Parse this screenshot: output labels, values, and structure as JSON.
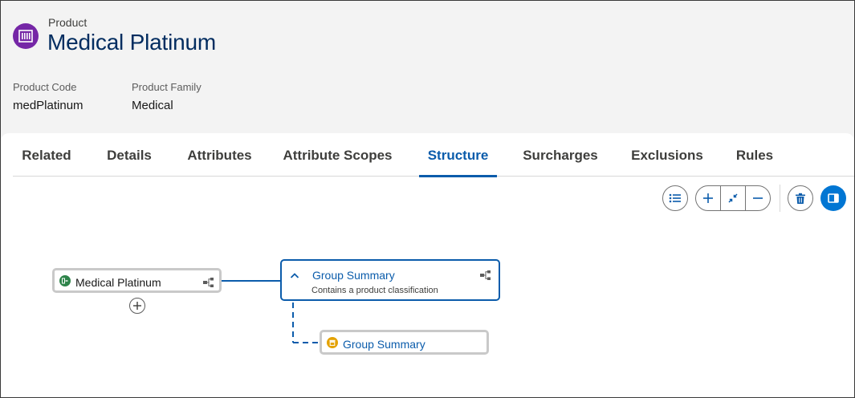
{
  "header": {
    "object_label": "Product",
    "title": "Medical Platinum",
    "icon": "product-icon",
    "fields": [
      {
        "label": "Product Code",
        "value": "medPlatinum"
      },
      {
        "label": "Product Family",
        "value": "Medical"
      }
    ]
  },
  "tabs": [
    {
      "label": "Related",
      "active": false
    },
    {
      "label": "Details",
      "active": false
    },
    {
      "label": "Attributes",
      "active": false
    },
    {
      "label": "Attribute Scopes",
      "active": false
    },
    {
      "label": "Structure",
      "active": true
    },
    {
      "label": "Surcharges",
      "active": false
    },
    {
      "label": "Exclusions",
      "active": false
    },
    {
      "label": "Rules",
      "active": false
    }
  ],
  "toolbar": {
    "icons": [
      "list-icon",
      "plus-icon",
      "collapse-icon",
      "minus-icon",
      "delete-icon",
      "panel-icon"
    ]
  },
  "tree": {
    "root": {
      "label": "Medical Platinum",
      "icon": "product-icon"
    },
    "group": {
      "label": "Group Summary",
      "description": "Contains a product classification"
    },
    "child": {
      "label": "Group Summary",
      "icon": "group-icon"
    }
  },
  "colors": {
    "brand_purple": "#7526a6",
    "accent_blue": "#0b5cab",
    "primary_button": "#0176d3",
    "product_green": "#2e844a",
    "group_yellow": "#e4a201"
  }
}
